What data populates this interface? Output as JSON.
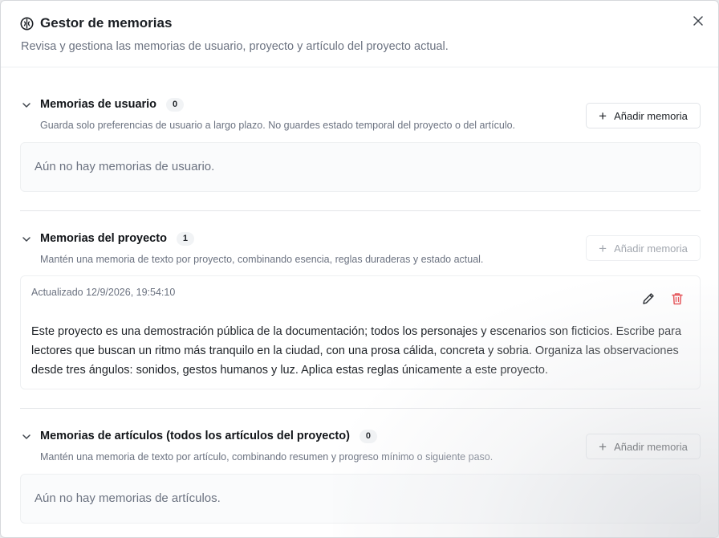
{
  "dialog": {
    "title": "Gestor de memorias",
    "subtitle": "Revisa y gestiona las memorias de usuario, proyecto y artículo del proyecto actual.",
    "close_label": "×"
  },
  "sections": {
    "user": {
      "title": "Memorias de usuario",
      "count": "0",
      "description": "Guarda solo preferencias de usuario a largo plazo. No guardes estado temporal del proyecto o del artículo.",
      "add_label": "Añadir memoria",
      "empty_text": "Aún no hay memorias de usuario."
    },
    "project": {
      "title": "Memorias del proyecto",
      "count": "1",
      "description": "Mantén una memoria de texto por proyecto, combinando esencia, reglas duraderas y estado actual.",
      "add_label": "Añadir memoria",
      "add_disabled": true,
      "memory": {
        "updated": "Actualizado 12/9/2026, 19:54:10",
        "text": "Este proyecto es una demostración pública de la documentación; todos los personajes y escenarios son ficticios. Escribe para lectores que buscan un ritmo más tranquilo en la ciudad, con una prosa cálida, concreta y sobria. Organiza las observaciones desde tres ángulos: sonidos, gestos humanos y luz. Aplica estas reglas únicamente a este proyecto."
      }
    },
    "article": {
      "title": "Memorias de artículos (todos los artículos del proyecto)",
      "count": "0",
      "description": "Mantén una memoria de texto por artículo, combinando resumen y progreso mínimo o siguiente paso.",
      "add_label": "Añadir memoria",
      "empty_text": "Aún no hay memorias de artículos."
    }
  },
  "icons": {
    "title": "brain-icon",
    "close": "close-icon",
    "collapse": "chevron-down-icon",
    "add": "plus-icon",
    "edit": "pencil-icon",
    "delete": "trash-icon"
  },
  "colors": {
    "delete": "#e5484d",
    "muted_text": "#6b7280",
    "disabled_text": "#a3a8b0"
  }
}
